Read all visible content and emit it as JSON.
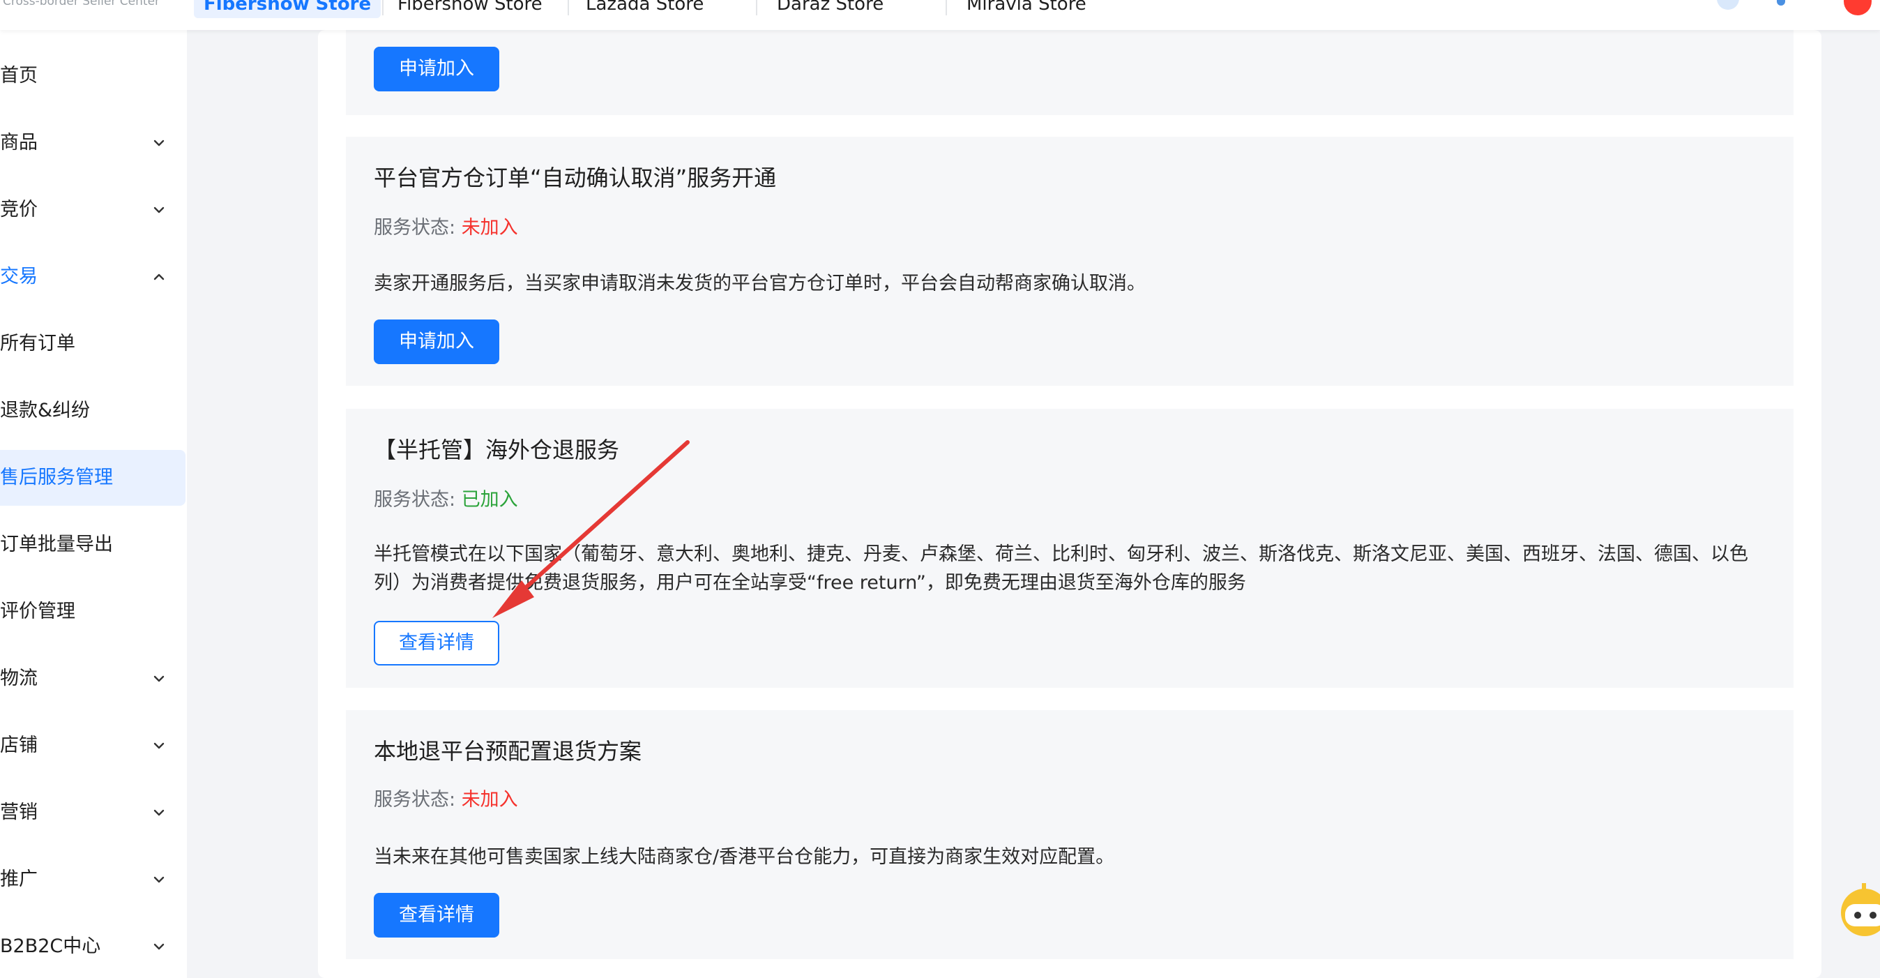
{
  "header": {
    "brand_subtitle": "Cross-border Seller Center",
    "store_tabs": [
      {
        "label": "Fibershow Store",
        "active": true
      },
      {
        "label": "Fibershow Store",
        "active": false
      },
      {
        "label": "Lazada Store",
        "active": false
      },
      {
        "label": "Daraz Store",
        "active": false
      },
      {
        "label": "Miravia Store",
        "active": false
      }
    ]
  },
  "sidebar": {
    "items": [
      {
        "label": "首页"
      },
      {
        "label": "商品"
      },
      {
        "label": "竞价"
      },
      {
        "label": "交易"
      },
      {
        "label": "所有订单"
      },
      {
        "label": "退款&纠纷"
      },
      {
        "label": "售后服务管理"
      },
      {
        "label": "订单批量导出"
      },
      {
        "label": "评价管理"
      },
      {
        "label": "物流"
      },
      {
        "label": "店铺"
      },
      {
        "label": "营销"
      },
      {
        "label": "推广"
      },
      {
        "label": "B2B2C中心"
      }
    ]
  },
  "services": {
    "status_label": "服务状态: ",
    "cards": [
      {
        "button_label": "申请加入"
      },
      {
        "title": "平台官方仓订单“自动确认取消”服务开通",
        "status": "未加入",
        "description": "卖家开通服务后，当买家申请取消未发货的平台官方仓订单时，平台会自动帮商家确认取消。",
        "button_label": "申请加入"
      },
      {
        "title": "【半托管】海外仓退服务",
        "status": "已加入",
        "description": "半托管模式在以下国家（葡萄牙、意大利、奥地利、捷克、丹麦、卢森堡、荷兰、比利时、匈牙利、波兰、斯洛伐克、斯洛文尼亚、美国、西班牙、法国、德国、以色列）为消费者提供免费退货服务，用户可在全站享受“free return”，即免费无理由退货至海外仓库的服务",
        "button_label": "查看详情"
      },
      {
        "title": "本地退平台预配置退货方案",
        "status": "未加入",
        "description": "当未来在其他可售卖国家上线大陆商家仓/香港平台仓能力，可直接为商家生效对应配置。",
        "button_label": "查看详情"
      }
    ]
  },
  "colors": {
    "primary": "#1677ff",
    "status_not_joined": "#f5322d",
    "status_joined": "#2ba33a",
    "annotation_arrow": "#e53935"
  },
  "icons": [
    "chevron-down-icon",
    "chevron-up-icon",
    "red-arrow-annotation",
    "assistant-robot-icon"
  ]
}
